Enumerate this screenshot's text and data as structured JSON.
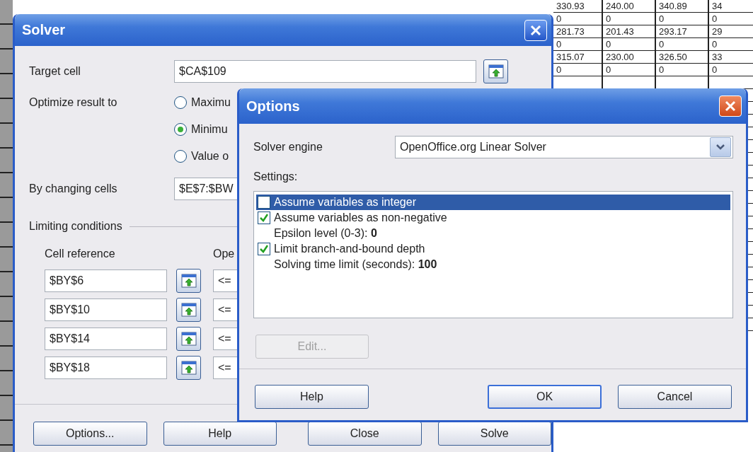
{
  "spreadsheet": {
    "rows": [
      [
        "330.93",
        "240.00",
        "340.89",
        "34"
      ],
      [
        "0",
        "0",
        "0",
        "0"
      ],
      [
        "281.73",
        "201.43",
        "293.17",
        "29"
      ],
      [
        "0",
        "0",
        "0",
        "0"
      ],
      [
        "315.07",
        "230.00",
        "326.50",
        "33"
      ],
      [
        "0",
        "0",
        "0",
        "0"
      ]
    ]
  },
  "solver": {
    "title": "Solver",
    "target": {
      "label": "Target cell",
      "value": "$CA$109"
    },
    "optimize": {
      "label": "Optimize result to",
      "options": [
        {
          "label": "Maximu",
          "selected": false
        },
        {
          "label": "Minimu",
          "selected": true
        },
        {
          "label": "Value o",
          "selected": false
        }
      ]
    },
    "changing": {
      "label": "By changing cells",
      "value": "$E$7:$BW"
    },
    "limiting": {
      "label": "Limiting conditions",
      "cell_header": "Cell reference",
      "op_header": "Ope",
      "conditions": [
        {
          "cell": "$BY$6",
          "op": "<="
        },
        {
          "cell": "$BY$10",
          "op": "<="
        },
        {
          "cell": "$BY$14",
          "op": "<="
        },
        {
          "cell": "$BY$18",
          "op": "<="
        }
      ]
    },
    "buttons": [
      "Options...",
      "Help",
      "Close",
      "Solve"
    ]
  },
  "options": {
    "title": "Options",
    "engine": {
      "label": "Solver engine",
      "value": "OpenOffice.org Linear Solver"
    },
    "settings_label": "Settings:",
    "settings": [
      {
        "kind": "checkbox",
        "text": "Assume variables as integer",
        "checked": false,
        "selected": true
      },
      {
        "kind": "checkbox",
        "text": "Assume variables as non-negative",
        "checked": true,
        "selected": false
      },
      {
        "kind": "value",
        "text": "Epsilon level (0-3): **0**",
        "selected": false
      },
      {
        "kind": "checkbox",
        "text": "Limit branch-and-bound depth",
        "checked": true,
        "selected": false
      },
      {
        "kind": "value",
        "text": "Solving time limit (seconds): **100**",
        "selected": false
      }
    ],
    "edit_button": {
      "label": "Edit...",
      "disabled": true
    },
    "buttons": [
      {
        "label": "Help",
        "default": false
      },
      {
        "label": "OK",
        "default": true
      },
      {
        "label": "Cancel",
        "default": false
      }
    ]
  }
}
